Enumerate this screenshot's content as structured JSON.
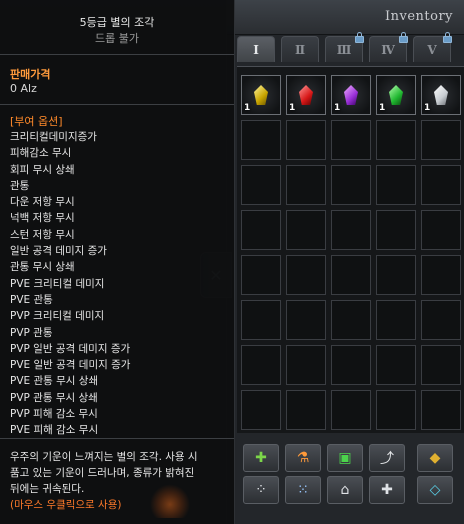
{
  "inventory": {
    "title": "Inventory",
    "tabs": [
      {
        "label": "Ⅰ",
        "locked": false,
        "active": true
      },
      {
        "label": "Ⅱ",
        "locked": false,
        "active": false
      },
      {
        "label": "Ⅲ",
        "locked": true,
        "active": false
      },
      {
        "label": "Ⅳ",
        "locked": true,
        "active": false
      },
      {
        "label": "Ⅴ",
        "locked": true,
        "active": false
      }
    ],
    "items": [
      {
        "icon": "yellow-star-fragment-icon",
        "qty": "1",
        "color": "yellow"
      },
      {
        "icon": "red-star-fragment-icon",
        "qty": "1",
        "color": "red"
      },
      {
        "icon": "purple-star-fragment-icon",
        "qty": "1",
        "color": "purple"
      },
      {
        "icon": "green-star-fragment-icon",
        "qty": "1",
        "color": "green"
      },
      {
        "icon": "white-star-fragment-icon",
        "qty": "1",
        "color": "white"
      }
    ],
    "toolbar": [
      {
        "name": "add-sword-button",
        "glyph": "✚"
      },
      {
        "name": "potion-button",
        "glyph": "⚗"
      },
      {
        "name": "lock-button",
        "glyph": "▣"
      },
      {
        "name": "arrow-button",
        "glyph": "⤴"
      },
      {
        "name": "gold-button",
        "glyph": "◆"
      },
      {
        "name": "grid-button",
        "glyph": "⁘"
      },
      {
        "name": "settings-grid-button",
        "glyph": "⁙"
      },
      {
        "name": "house-button",
        "glyph": "⌂"
      },
      {
        "name": "move-button",
        "glyph": "✚"
      },
      {
        "name": "diamond-button",
        "glyph": "◇"
      }
    ],
    "handle_glyph": "✕"
  },
  "tooltip": {
    "name": "5등급 별의 조각",
    "subtitle": "드롭 불가",
    "price_label": "판매가격",
    "price_value": "0 Alz",
    "options_title": "[부여 옵션]",
    "options": [
      "크리티컬데미지증가",
      "피해감소 무시",
      "회피 무시 상쇄",
      "관통",
      "다운 저항 무시",
      "넉백 저항 무시",
      "스턴 저항 무시",
      "일반 공격 데미지 증가",
      "관통 무시 상쇄",
      "PVE 크리티컬 데미지",
      "PVE 관통",
      "PVP 크리티컬 데미지",
      "PVP 관통",
      "PVP 일반 공격 데미지 증가",
      "PVE 일반 공격 데미지 증가",
      "PVE 관통 무시 상쇄",
      "PVP 관통 무시 상쇄",
      "PVP 피해 감소 무시",
      "PVE 피해 감소 무시"
    ],
    "desc_lines": [
      "우주의 기운이 느껴지는 별의 조각. 사용 시",
      "품고 있는 기운이 드러나며, 종류가 밝혀진",
      "뒤에는 귀속된다."
    ],
    "hint": "(마우스 우클릭으로 사용)"
  }
}
